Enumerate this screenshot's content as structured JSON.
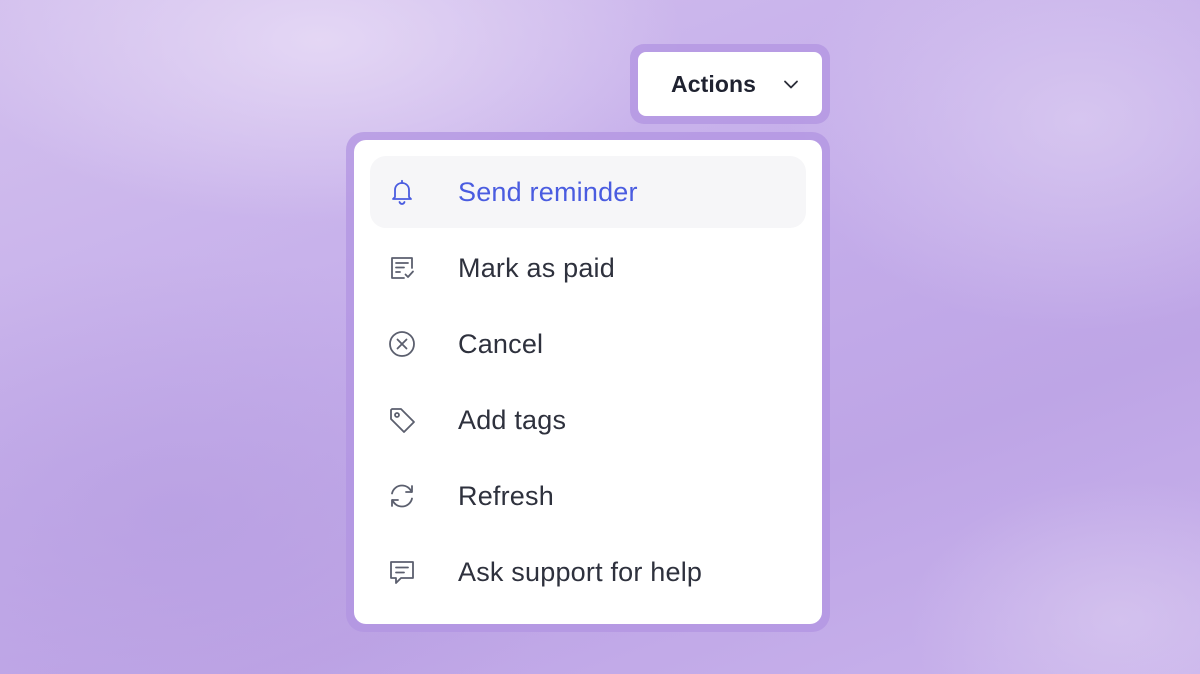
{
  "actions": {
    "label": "Actions",
    "icon": "chevron-down-icon"
  },
  "menu": {
    "items": [
      {
        "label": "Send reminder",
        "icon": "bell-icon",
        "active": true
      },
      {
        "label": "Mark as paid",
        "icon": "receipt-check-icon",
        "active": false
      },
      {
        "label": "Cancel",
        "icon": "circle-x-icon",
        "active": false
      },
      {
        "label": "Add tags",
        "icon": "tag-icon",
        "active": false
      },
      {
        "label": "Refresh",
        "icon": "refresh-icon",
        "active": false
      },
      {
        "label": "Ask support for help",
        "icon": "message-icon",
        "active": false
      }
    ]
  },
  "colors": {
    "accent": "#4a5ce0",
    "text": "#2e313d",
    "icon": "#5b5f6e",
    "highlight": "#f6f6f8"
  }
}
